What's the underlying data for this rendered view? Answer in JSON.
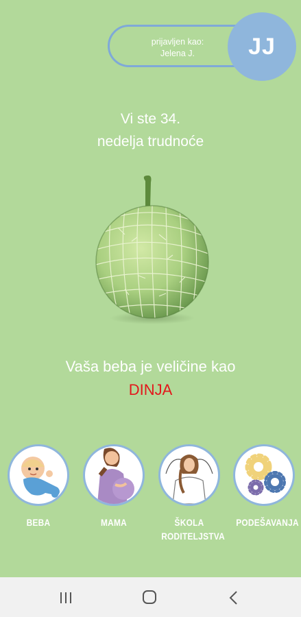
{
  "user": {
    "logged_in_label": "prijavljen kao:",
    "name": "Jelena J.",
    "initials": "JJ"
  },
  "pregnancy": {
    "week_line1": "Vi ste 34.",
    "week_line2": "nedelja trudnoće"
  },
  "baby_size": {
    "text": "Vaša beba je veličine kao",
    "fruit": "DINJA",
    "fruit_icon": "melon-icon"
  },
  "nav": [
    {
      "label": "BEBA",
      "icon": "baby-icon"
    },
    {
      "label": "MAMA",
      "icon": "pregnant-woman-icon"
    },
    {
      "label_line1": "ŠKOLA",
      "label_line2": "RODITELJSTVA",
      "icon": "stretching-woman-icon"
    },
    {
      "label": "PODEŠAVANJA",
      "icon": "gears-icon"
    }
  ],
  "system_nav": [
    "recent-apps-icon",
    "home-icon",
    "back-icon"
  ],
  "colors": {
    "background": "#b2d99a",
    "accent": "#8fb6dc",
    "highlight": "#e3171b"
  }
}
